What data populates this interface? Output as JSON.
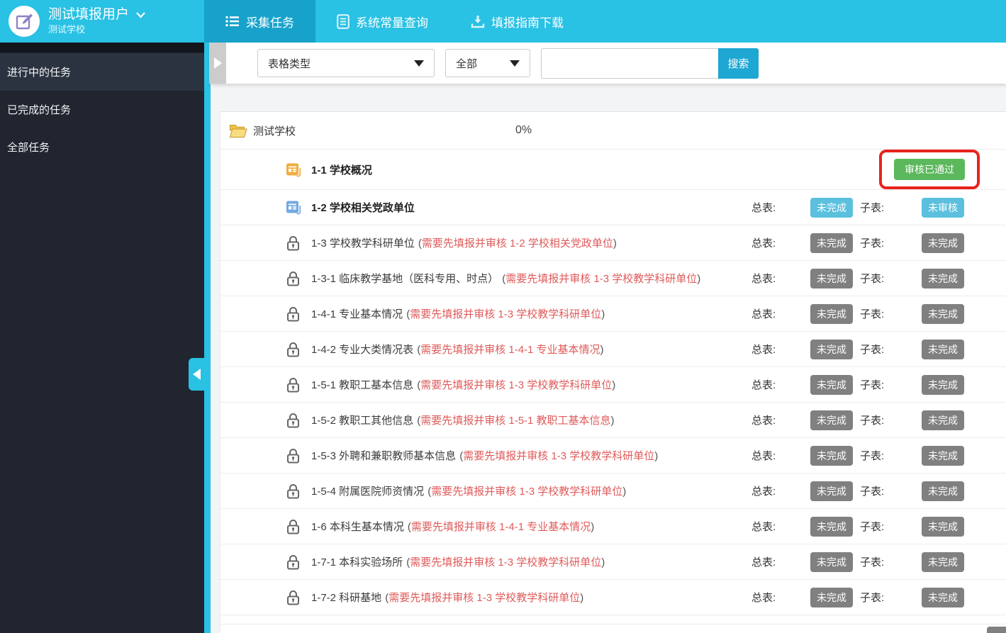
{
  "header": {
    "user": {
      "name": "测试填报用户",
      "org": "测试学校"
    },
    "tabs": [
      {
        "label": "采集任务",
        "icon": "list-icon",
        "active": true
      },
      {
        "label": "系统常量查询",
        "icon": "document-icon",
        "active": false
      },
      {
        "label": "填报指南下载",
        "icon": "download-icon",
        "active": false
      }
    ]
  },
  "sidebar": {
    "items": [
      {
        "label": "进行中的任务",
        "active": true
      },
      {
        "label": "已完成的任务",
        "active": false
      },
      {
        "label": "全部任务",
        "active": false
      }
    ]
  },
  "filters": {
    "type_select": "表格类型",
    "status_select": "全部",
    "search_value": "",
    "search_button": "搜索"
  },
  "task_panel": {
    "group": {
      "name": "测试学校",
      "progress": "0%"
    },
    "col_labels": {
      "main": "总表:",
      "sub": "子表:"
    },
    "status_colors": {
      "blue": "#5bc0de",
      "gray": "#808080",
      "green": "#5cb85c"
    },
    "annotation_color": "#e8231e",
    "rows": [
      {
        "icon": "form-icon-orange",
        "title": "1-1 学校概况",
        "status": {
          "text": "审核已通过",
          "tone": "green"
        },
        "highlighted": true
      },
      {
        "icon": "form-icon-blue",
        "title": "1-2 学校相关党政单位",
        "main": {
          "text": "未完成",
          "tone": "blue"
        },
        "sub": {
          "text": "未审核",
          "tone": "blue"
        }
      },
      {
        "icon": "lock-icon",
        "title": "1-3 学校教学科研单位",
        "dep_open": "(",
        "dep_text": "需要先填报并审核 1-2 学校相关党政单位",
        "dep_close": ")",
        "main": {
          "text": "未完成",
          "tone": "gray"
        },
        "sub": {
          "text": "未完成",
          "tone": "gray"
        }
      },
      {
        "icon": "lock-icon",
        "title": "1-3-1 临床教学基地（医科专用、时点）",
        "dep_open": "(",
        "dep_text": "需要先填报并审核 1-3 学校教学科研单位",
        "dep_close": ")",
        "main": {
          "text": "未完成",
          "tone": "gray"
        },
        "sub": {
          "text": "未完成",
          "tone": "gray"
        }
      },
      {
        "icon": "lock-icon",
        "title": "1-4-1 专业基本情况",
        "dep_open": "(",
        "dep_text": "需要先填报并审核 1-3 学校教学科研单位",
        "dep_close": ")",
        "main": {
          "text": "未完成",
          "tone": "gray"
        },
        "sub": {
          "text": "未完成",
          "tone": "gray"
        }
      },
      {
        "icon": "lock-icon",
        "title": "1-4-2 专业大类情况表",
        "dep_open": "(",
        "dep_text": "需要先填报并审核 1-4-1 专业基本情况",
        "dep_close": ")",
        "main": {
          "text": "未完成",
          "tone": "gray"
        },
        "sub": {
          "text": "未完成",
          "tone": "gray"
        }
      },
      {
        "icon": "lock-icon",
        "title": "1-5-1 教职工基本信息",
        "dep_open": "(",
        "dep_text": "需要先填报并审核 1-3 学校教学科研单位",
        "dep_close": ")",
        "main": {
          "text": "未完成",
          "tone": "gray"
        },
        "sub": {
          "text": "未完成",
          "tone": "gray"
        }
      },
      {
        "icon": "lock-icon",
        "title": "1-5-2 教职工其他信息",
        "dep_open": "(",
        "dep_text": "需要先填报并审核 1-5-1 教职工基本信息",
        "dep_close": ")",
        "main": {
          "text": "未完成",
          "tone": "gray"
        },
        "sub": {
          "text": "未完成",
          "tone": "gray"
        }
      },
      {
        "icon": "lock-icon",
        "title": "1-5-3 外聘和兼职教师基本信息",
        "dep_open": "(",
        "dep_text": "需要先填报并审核 1-3 学校教学科研单位",
        "dep_close": ")",
        "main": {
          "text": "未完成",
          "tone": "gray"
        },
        "sub": {
          "text": "未完成",
          "tone": "gray"
        }
      },
      {
        "icon": "lock-icon",
        "title": "1-5-4 附属医院师资情况",
        "dep_open": "(",
        "dep_text": "需要先填报并审核 1-3 学校教学科研单位",
        "dep_close": ")",
        "main": {
          "text": "未完成",
          "tone": "gray"
        },
        "sub": {
          "text": "未完成",
          "tone": "gray"
        }
      },
      {
        "icon": "lock-icon",
        "title": "1-6 本科生基本情况",
        "dep_open": "(",
        "dep_text": "需要先填报并审核 1-4-1 专业基本情况",
        "dep_close": ")",
        "main": {
          "text": "未完成",
          "tone": "gray"
        },
        "sub": {
          "text": "未完成",
          "tone": "gray"
        }
      },
      {
        "icon": "lock-icon",
        "title": "1-7-1 本科实验场所",
        "dep_open": "(",
        "dep_text": "需要先填报并审核 1-3 学校教学科研单位",
        "dep_close": ")",
        "main": {
          "text": "未完成",
          "tone": "gray"
        },
        "sub": {
          "text": "未完成",
          "tone": "gray"
        }
      },
      {
        "icon": "lock-icon",
        "title": "1-7-2 科研基地",
        "dep_open": "(",
        "dep_text": "需要先填报并审核 1-3 学校教学科研单位",
        "dep_close": ")",
        "main": {
          "text": "未完成",
          "tone": "gray"
        },
        "sub": {
          "text": "未完成",
          "tone": "gray"
        }
      }
    ]
  }
}
